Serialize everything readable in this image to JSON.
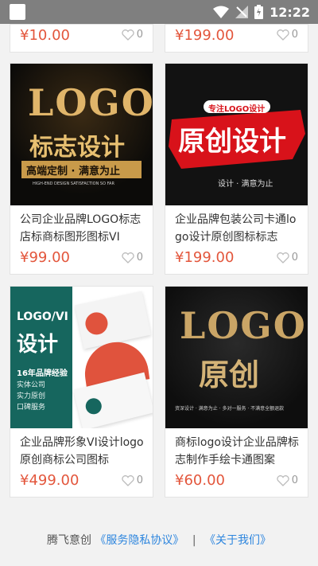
{
  "status": {
    "time": "12:22"
  },
  "top_cards": [
    {
      "price": "¥10.00",
      "likes": "0"
    },
    {
      "price": "¥199.00",
      "likes": "0"
    }
  ],
  "cards": [
    {
      "title": "公司企业品牌LOGO标志店标商标图形图标VI",
      "price": "¥99.00",
      "likes": "0",
      "img": {
        "big": "LOGO",
        "sub": "标志设计",
        "banner": "高端定制 · 满意为止",
        "small": "HIGH-END DESIGN SATISFACTION SO FAR"
      }
    },
    {
      "title": "企业品牌包装公司卡通logo设计原创图标标志",
      "price": "¥199.00",
      "likes": "0",
      "img": {
        "tag": "专注LOGO设计",
        "big": "原创设计",
        "small": "设计 · 满意为止"
      }
    },
    {
      "title": "企业品牌形象VI设计logo原创商标公司图标",
      "price": "¥499.00",
      "likes": "0",
      "img": {
        "big1": "LOGO/VI",
        "big2": "设计",
        "line1": "16年品牌经验",
        "line2": "实体公司",
        "line3": "实力原创",
        "line4": "口碑服务"
      }
    },
    {
      "title": "商标logo设计企业品牌标志制作手绘卡通图案",
      "price": "¥60.00",
      "likes": "0",
      "img": {
        "big": "LOGO",
        "sub": "原创",
        "small": "资深设计 · 满意为止 · 多对一服务 · 不满意全额退款"
      }
    }
  ],
  "footer": {
    "company": "腾飞意创",
    "privacy": "《服务隐私协议》",
    "separator": "|",
    "about": "《关于我们》"
  },
  "colors": {
    "price": "#e3563c",
    "link": "#2e86de",
    "statusbar": "#7f7f7f"
  }
}
